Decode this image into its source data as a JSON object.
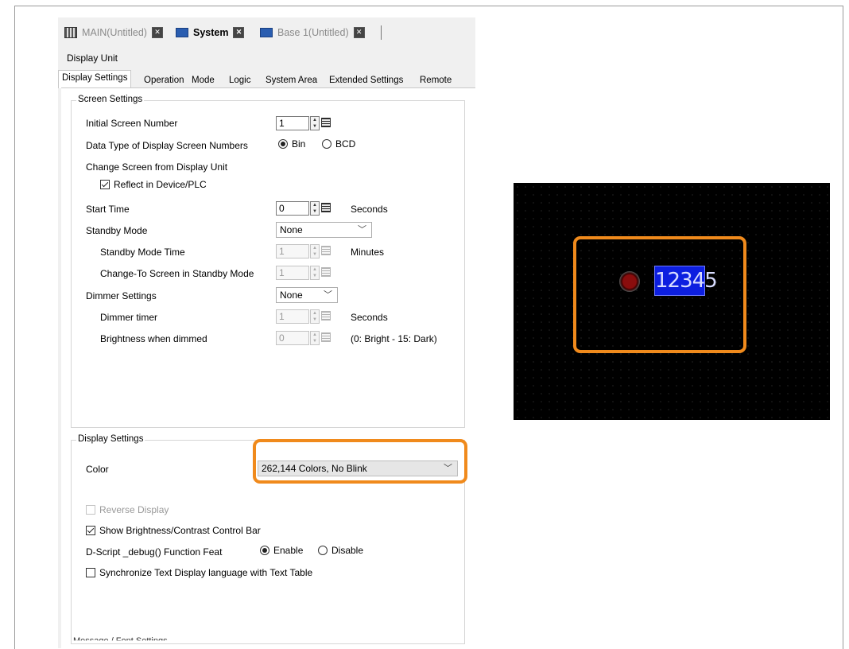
{
  "doc_tabs": [
    {
      "label": "MAIN(Untitled)",
      "active": false
    },
    {
      "label": "System",
      "active": true
    },
    {
      "label": "Base 1(Untitled)",
      "active": false
    }
  ],
  "unit_title": "Display Unit",
  "settings_tabs": [
    "Display Settings",
    "Operation",
    "Mode",
    "Logic",
    "System Area",
    "Extended Settings",
    "Remote View"
  ],
  "screen_settings": {
    "legend": "Screen Settings",
    "initial_screen_label": "Initial Screen Number",
    "initial_screen_value": "1",
    "data_type_label": "Data Type of Display Screen Numbers",
    "data_type_bin": "Bin",
    "data_type_bcd": "BCD",
    "change_screen_label": "Change Screen from Display Unit",
    "reflect_label": "Reflect in Device/PLC",
    "start_time_label": "Start Time",
    "start_time_value": "0",
    "seconds": "Seconds",
    "standby_mode_label": "Standby Mode",
    "standby_mode_value": "None",
    "standby_time_label": "Standby Mode Time",
    "standby_time_value": "1",
    "minutes": "Minutes",
    "change_to_label": "Change-To Screen in Standby Mode",
    "change_to_value": "1",
    "dimmer_label": "Dimmer Settings",
    "dimmer_value": "None",
    "dimmer_timer_label": "Dimmer timer",
    "dimmer_timer_value": "1",
    "dimmer_seconds": "Seconds",
    "brightness_label": "Brightness when dimmed",
    "brightness_value": "0",
    "brightness_hint": "(0: Bright - 15: Dark)"
  },
  "display_settings": {
    "legend": "Display Settings",
    "color_label": "Color",
    "color_value": "262,144 Colors, No Blink",
    "reverse_label": "Reverse Display",
    "show_brightness_label": "Show Brightness/Contrast Control Bar",
    "dscript_label": "D-Script _debug() Function Feat",
    "enable_label": "Enable",
    "disable_label": "Disable",
    "sync_label": "Synchronize Text Display language with Text Table"
  },
  "cut_off_text": "Message / Font Settings",
  "preview": {
    "numeric_value": "12345"
  },
  "colors": {
    "highlight": "#f08a1c",
    "numeric_bg": "#0d1fe0"
  }
}
